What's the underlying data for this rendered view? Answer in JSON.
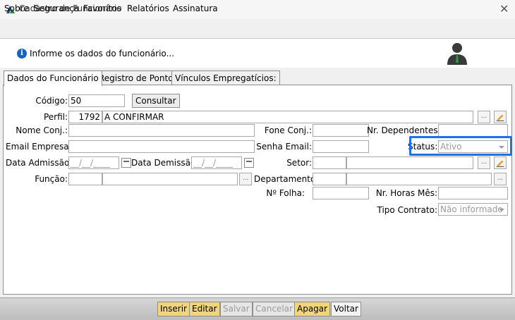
{
  "window": {
    "title": "Cadastro de Funcionário",
    "close_glyph": "✕"
  },
  "menu": [
    "Sobre",
    "Segurança",
    "Favoritos",
    "Relatórios",
    "Assinatura"
  ],
  "info": {
    "text": "Informe os dados do funcionário...",
    "icon_glyph": "i"
  },
  "tabs": [
    "Dados do Funcionário",
    "Registro de Pontos",
    "Vínculos Empregatícios:"
  ],
  "form": {
    "codigo": {
      "label": "Código:",
      "value": "50"
    },
    "consultar": "Consultar",
    "perfil": {
      "label": "Perfil:",
      "code": "1792",
      "name": "A CONFIRMAR"
    },
    "nome_conj": "Nome Conj.:",
    "fone_conj": "Fone Conj.:",
    "nr_dependentes": "Nr. Dependentes.:",
    "email_empresa": "Email Empresa:",
    "senha_email": "Senha Email:",
    "status": {
      "label": "Status:",
      "value": "Ativo"
    },
    "data_admissao": {
      "label": "Data Admissão:",
      "placeholder": "__/__/____"
    },
    "data_demissao": {
      "label": "Data Demissão:",
      "placeholder": "__/__/____"
    },
    "setor": "Setor:",
    "funcao": "Função:",
    "departamento": "Departamento:",
    "n_folha": "Nº Folha:",
    "nr_horas_mes": "Nr. Horas Mês:",
    "tipo_contrato": {
      "label": "Tipo Contrato:",
      "value": "Não informado"
    },
    "ellipsis": "..."
  },
  "actions": [
    "Inserir",
    "Editar",
    "Salvar",
    "Cancelar",
    "Apagar",
    "Voltar"
  ],
  "colors": {
    "highlight": "#1a73e8",
    "action_yellow": "#f2d57a"
  }
}
